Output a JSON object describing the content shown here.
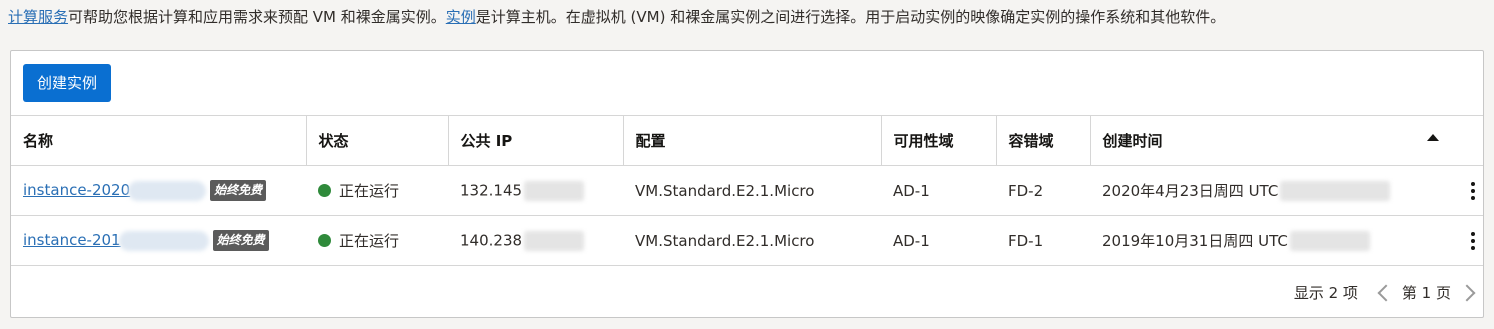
{
  "intro": {
    "link1": "计算服务",
    "text1": "可帮助您根据计算和应用需求来预配 VM 和裸金属实例。",
    "link2": "实例",
    "text2": "是计算主机。在虚拟机 (VM) 和裸金属实例之间进行选择。用于启动实例的映像确定实例的操作系统和其他软件。"
  },
  "toolbar": {
    "create_label": "创建实例"
  },
  "table": {
    "headers": [
      "名称",
      "状态",
      "公共 IP",
      "配置",
      "可用性域",
      "容错域",
      "创建时间"
    ],
    "rows": [
      {
        "name": "instance-2020",
        "badge": "始终免费",
        "status": "正在运行",
        "ip": "132.145",
        "shape": "VM.Standard.E2.1.Micro",
        "ad": "AD-1",
        "fd": "FD-2",
        "created": "2020年4月23日周四 UTC"
      },
      {
        "name": "instance-201",
        "badge": "始终免费",
        "status": "正在运行",
        "ip": "140.238",
        "shape": "VM.Standard.E2.1.Micro",
        "ad": "AD-1",
        "fd": "FD-1",
        "created": "2019年10月31日周四 UTC"
      }
    ]
  },
  "footer": {
    "count": "显示 2 项",
    "page": "第 1 页"
  },
  "colors": {
    "link": "#2a6fb5",
    "primary": "#0a6fd1",
    "running": "#2f8a3b",
    "badge": "#5b5b5b"
  }
}
